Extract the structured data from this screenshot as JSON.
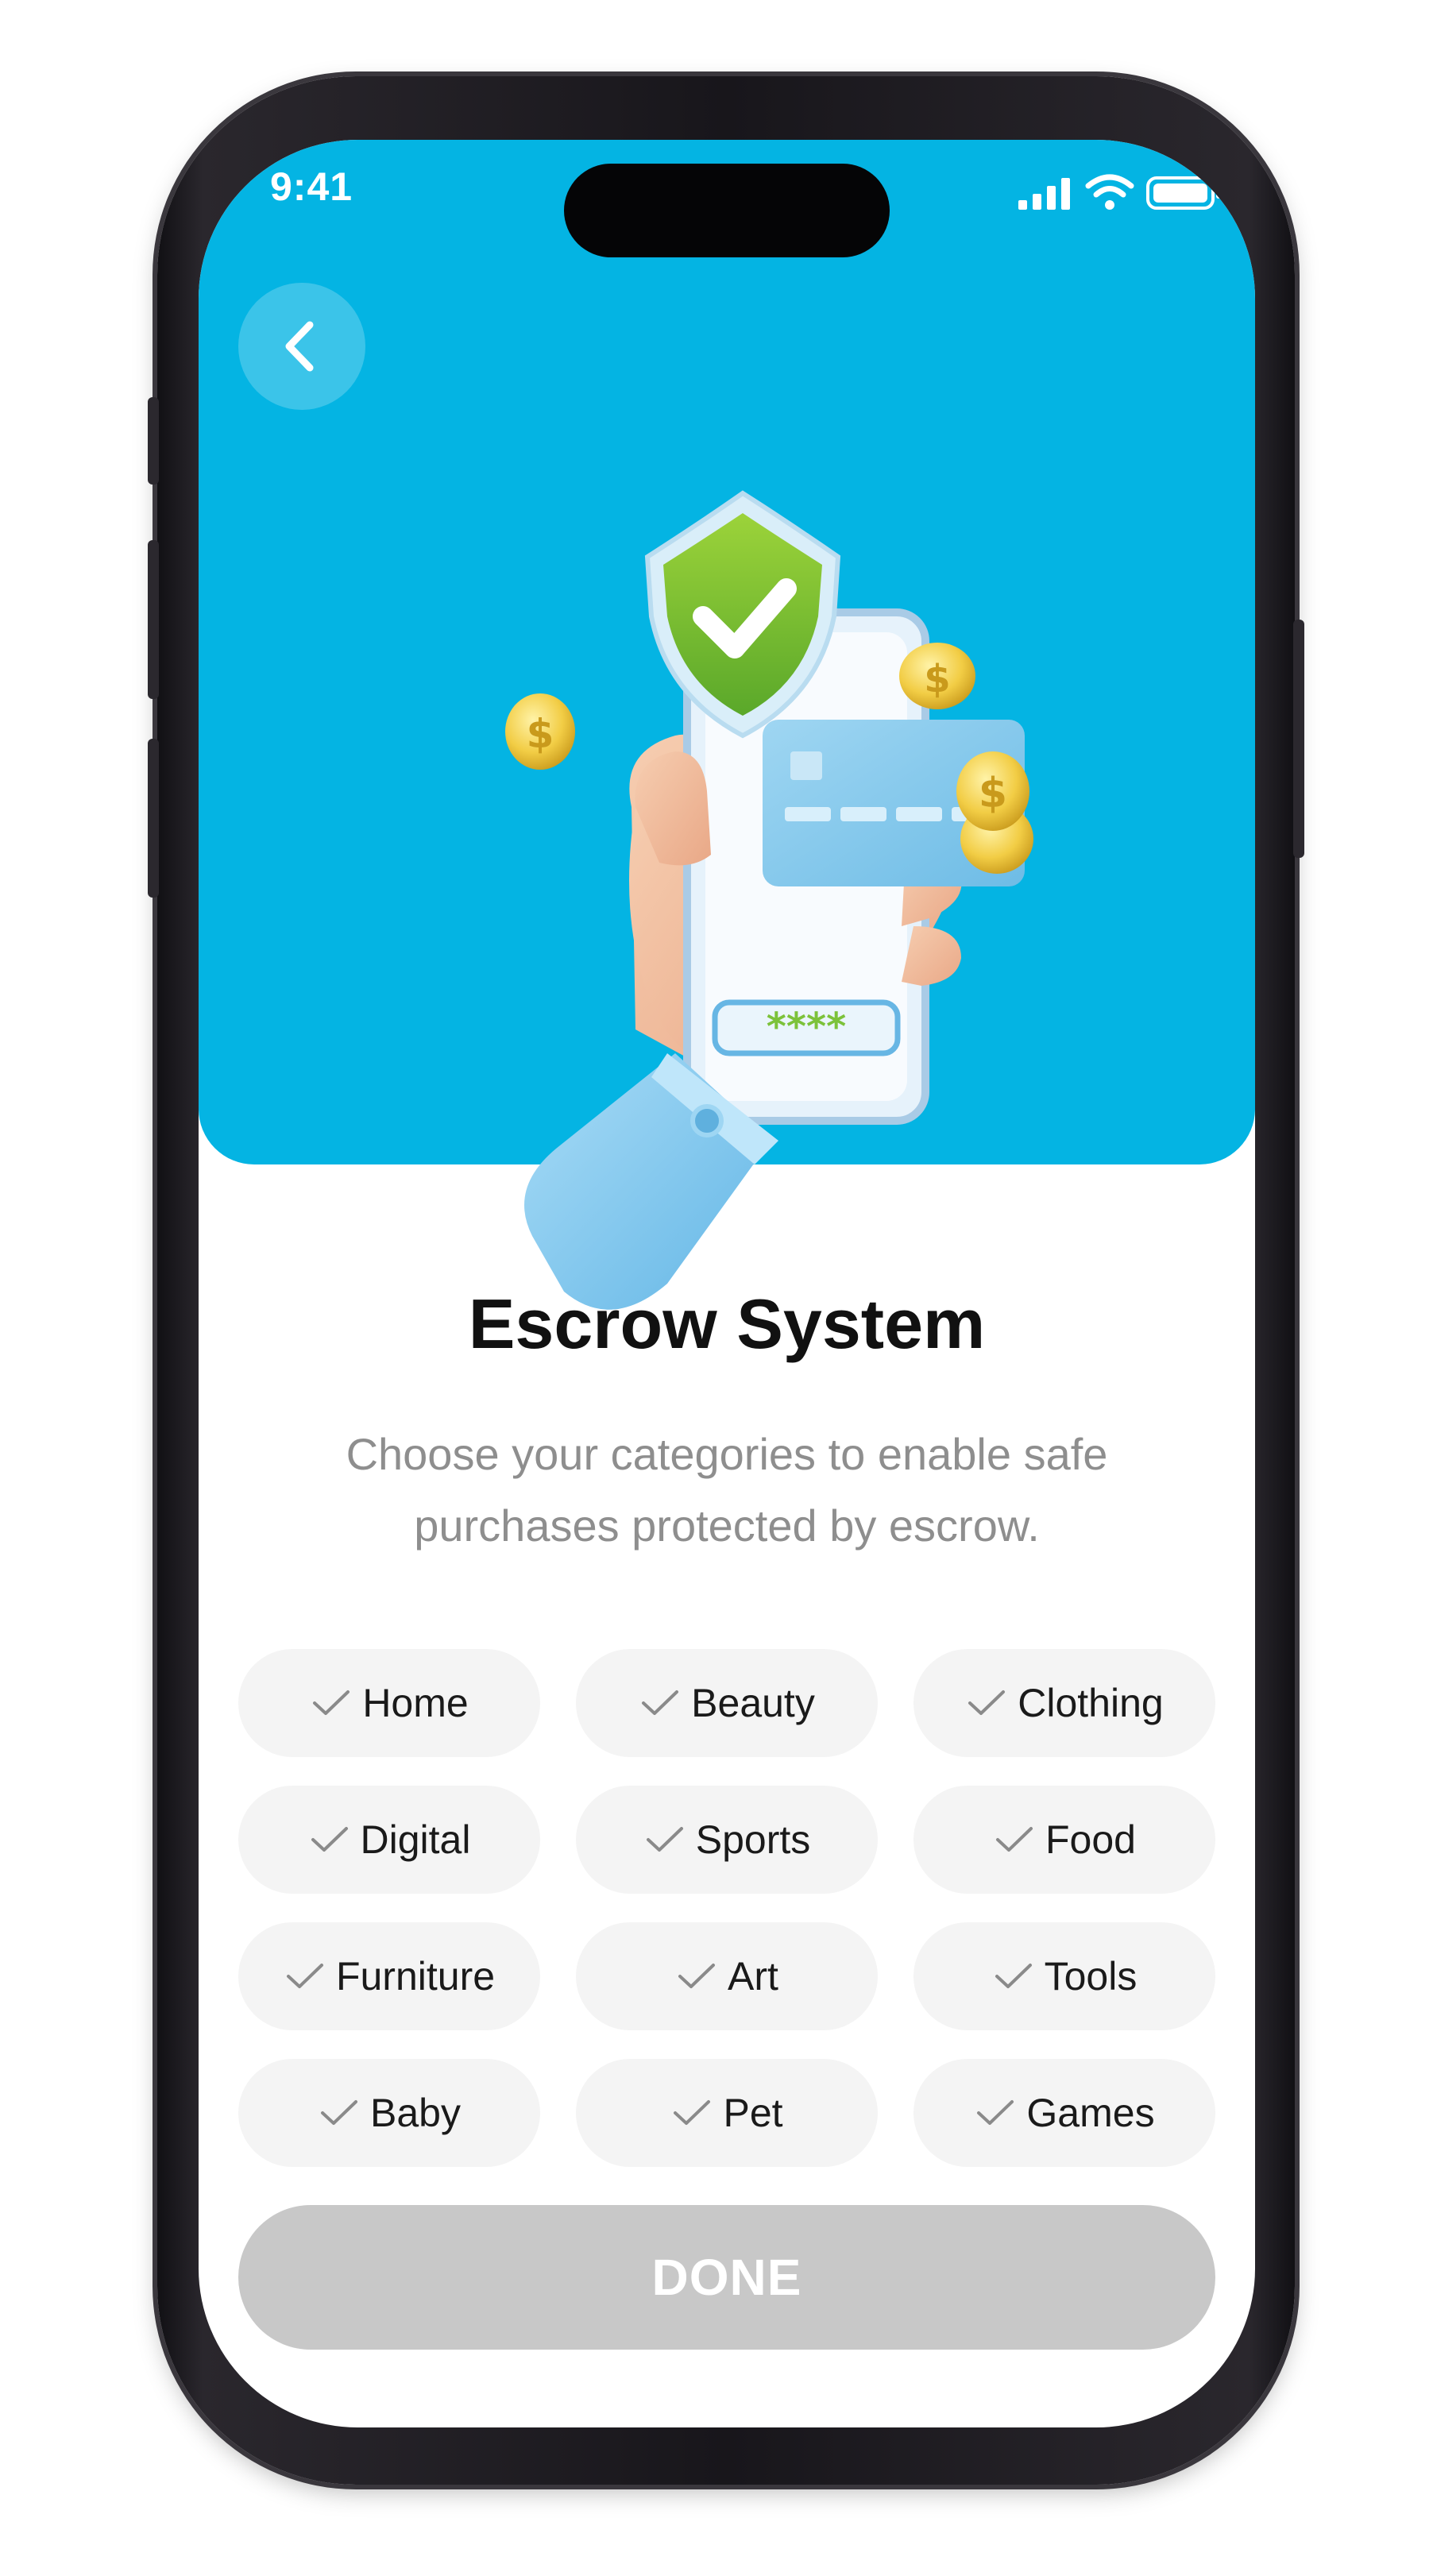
{
  "status_bar": {
    "time": "9:41",
    "icons": [
      "cellular-signal-icon",
      "wifi-icon",
      "battery-icon"
    ]
  },
  "header": {
    "back_icon": "chevron-left-icon",
    "accent_color": "#04b4e3"
  },
  "illustration": {
    "pin_mask": "****",
    "icons": [
      "shield-check-icon",
      "credit-card-icon",
      "dollar-coin-icon",
      "hand-holding-phone-icon"
    ]
  },
  "content": {
    "title": "Escrow System",
    "subtitle_line1": "Choose your categories to enable safe",
    "subtitle_line2": "purchases protected by escrow."
  },
  "categories": [
    {
      "label": "Home"
    },
    {
      "label": "Beauty"
    },
    {
      "label": "Clothing"
    },
    {
      "label": "Digital"
    },
    {
      "label": "Sports"
    },
    {
      "label": "Food"
    },
    {
      "label": "Furniture"
    },
    {
      "label": "Art"
    },
    {
      "label": "Tools"
    },
    {
      "label": "Baby"
    },
    {
      "label": "Pet"
    },
    {
      "label": "Games"
    }
  ],
  "actions": {
    "done_label": "DONE",
    "done_enabled": false
  }
}
